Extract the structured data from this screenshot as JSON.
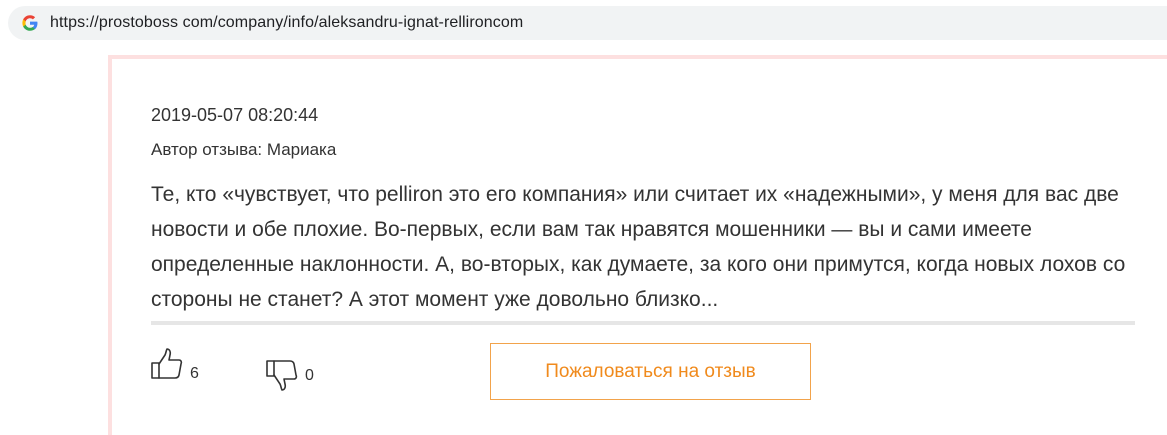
{
  "browser": {
    "url": "https://prostoboss com/company/info/aleksandru-ignat-rellironcom"
  },
  "review": {
    "date": "2019-05-07 08:20:44",
    "author": "Автор отзыва: Мариака",
    "text": "Те, кто «чувствует, что pelliron это его компания» или считает их «надежными», у меня для вас две новости и обе плохие. Во-первых, если вам так нравятся мошенники — вы и сами имеете определенные наклонности. А, во-вторых, как думаете, за кого они примутся, когда новых лохов со стороны не станет? А этот момент уже довольно близко..."
  },
  "votes": {
    "likes": "6",
    "dislikes": "0"
  },
  "actions": {
    "complain_label": "Пожаловаться на отзыв"
  },
  "colors": {
    "accent": "#f08a1c",
    "card_border": "#fde0e0",
    "text": "#333333"
  }
}
